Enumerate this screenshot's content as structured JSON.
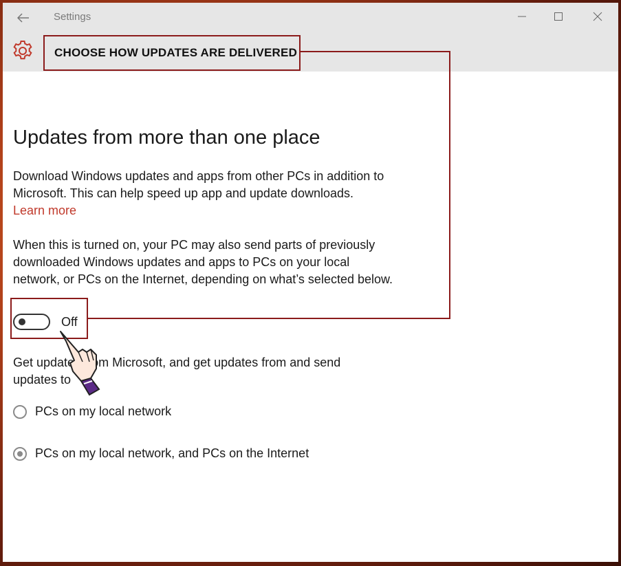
{
  "window": {
    "app_title": "Settings",
    "controls": [
      "minimize",
      "maximize",
      "close"
    ]
  },
  "header": {
    "title": "CHOOSE HOW UPDATES ARE DELIVERED",
    "icon": "gear-icon"
  },
  "main": {
    "section_title": "Updates from more than one place",
    "description": "Download Windows updates and apps from other PCs in addition to Microsoft. This can help speed up app and update downloads.",
    "learn_more": "Learn more",
    "info": "When this is turned on, your PC may also send parts of previously downloaded Windows updates and apps to PCs on your local network, or PCs on the Internet, depending on what’s selected below.",
    "toggle": {
      "state": "Off",
      "on": false
    },
    "get_updates_text": "Get updates from Microsoft, and get updates from and send updates to",
    "options": [
      {
        "label": "PCs on my local network",
        "selected": false
      },
      {
        "label": "PCs on my local network, and PCs on the Internet",
        "selected": true
      }
    ]
  },
  "colors": {
    "accent": "#c0392b",
    "callout": "#8b1a1a",
    "titlebar": "#e6e6e6"
  }
}
